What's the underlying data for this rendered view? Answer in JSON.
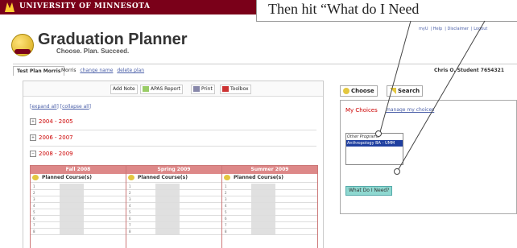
{
  "header": {
    "university": "UNIVERSITY OF MINNESOTA",
    "links": [
      "myU",
      "Help",
      "Disclaimer",
      "Logout"
    ]
  },
  "app": {
    "title": "Graduation Planner",
    "tagline": "Choose. Plan. Succeed."
  },
  "plan_bar": {
    "tab1": "Test Plan Morris",
    "tab2": "Morris",
    "change_name": "change name",
    "delete_plan": "delete plan",
    "user": "Chris O. Student",
    "user_id": "7654321"
  },
  "toolbar": {
    "add_note": "Add Note",
    "apas": "APAS Report",
    "print": "Print",
    "toolbox": "Toolbox"
  },
  "expand": {
    "expand_all": "expand all",
    "collapse_all": "collapse all"
  },
  "years": [
    {
      "label": "2004 - 2005",
      "toggle": "+"
    },
    {
      "label": "2006 - 2007",
      "toggle": "+"
    },
    {
      "label": "2008 - 2009",
      "toggle": "−"
    }
  ],
  "terms": [
    {
      "name": "Fall 2008",
      "sub": "Planned Course(s)"
    },
    {
      "name": "Spring 2009",
      "sub": "Planned Course(s)"
    },
    {
      "name": "Summer 2009",
      "sub": "Planned Course(s)"
    }
  ],
  "row_numbers": [
    "1",
    "2",
    "3",
    "4",
    "5",
    "6",
    "7",
    "8"
  ],
  "right_panel": {
    "tab_choose": "Choose",
    "tab_search": "Search",
    "my_choices": "My Choices",
    "manage": "manage my choices",
    "group": "Other Programs",
    "selected": "Anthropology BA - UMM",
    "what_do": "What Do I Need?"
  },
  "callout": {
    "text": "Then hit “What do I Need"
  },
  "colors": {
    "umn_maroon": "#7a0019",
    "umn_gold": "#ffcc33",
    "term_header": "#dd8888",
    "link": "#4a5fa8",
    "button_teal": "#8ed8d0"
  }
}
